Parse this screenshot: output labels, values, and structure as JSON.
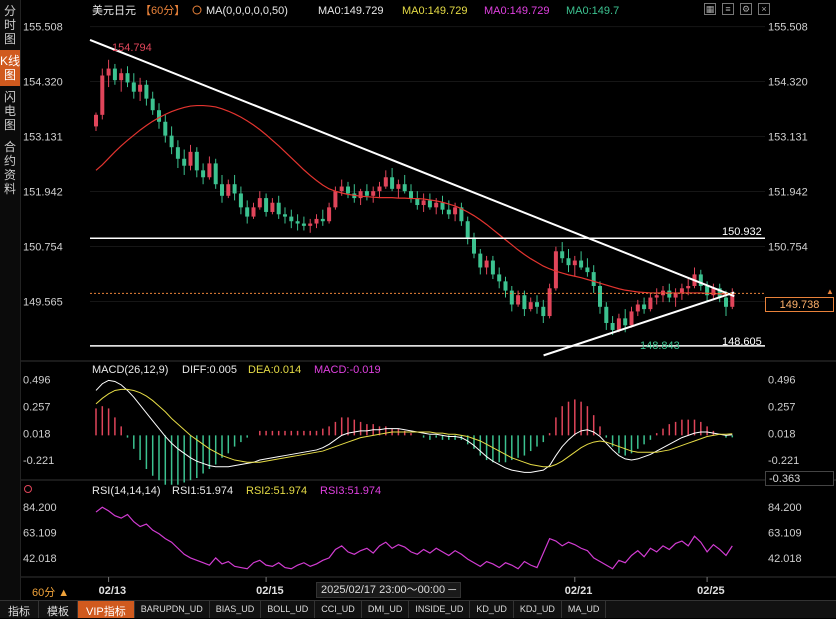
{
  "sidebar": {
    "tabs": [
      {
        "label": "分时图"
      },
      {
        "label": "K线图"
      },
      {
        "label": "闪电图"
      },
      {
        "label": "合约资料"
      }
    ],
    "active_index": 1
  },
  "header": {
    "symbol": "美元日元",
    "period": "【60分】",
    "ma_label": "MA(0,0,0,0,0,50)",
    "ma_values": [
      "MA0:149.729",
      "MA0:149.729",
      "MA0:149.729",
      "MA0:149.7"
    ]
  },
  "toolbar_icons": [
    "grid-icon",
    "list-icon",
    "settings-icon",
    "close-icon"
  ],
  "colors": {
    "up": "#e0455a",
    "down": "#3cc290",
    "ma": "#e3342f",
    "trend": "#ffffff",
    "current": "#e9823a",
    "diff": "#ffffff",
    "dea": "#e6dc46",
    "macd_text": "#e040e0",
    "rsi": "#d23cd2"
  },
  "chart_data": [
    {
      "type": "candlestick",
      "yticks": [
        "155.508",
        "154.320",
        "153.131",
        "151.942",
        "150.754",
        "149.565"
      ],
      "ylim": [
        148.3,
        155.65
      ],
      "xticks": [
        {
          "i": 2,
          "label": "02/13"
        },
        {
          "i": 27,
          "label": "02/15"
        },
        {
          "i": 76,
          "label": "02/21"
        },
        {
          "i": 97,
          "label": "02/25"
        }
      ],
      "annotations": {
        "high": "154.794",
        "low": "148.843",
        "level_1": "150.932",
        "level_2": "148.605",
        "current": "149.738"
      },
      "ohlc": [
        [
          153.35,
          153.65,
          153.25,
          153.6
        ],
        [
          153.6,
          154.6,
          153.5,
          154.45
        ],
        [
          154.45,
          154.79,
          154.2,
          154.6
        ],
        [
          154.6,
          154.7,
          154.25,
          154.35
        ],
        [
          154.35,
          154.6,
          154.1,
          154.5
        ],
        [
          154.5,
          154.65,
          154.2,
          154.3
        ],
        [
          154.3,
          154.5,
          153.95,
          154.1
        ],
        [
          154.1,
          154.4,
          153.9,
          154.25
        ],
        [
          154.25,
          154.35,
          153.8,
          153.95
        ],
        [
          153.95,
          154.1,
          153.6,
          153.7
        ],
        [
          153.7,
          153.85,
          153.3,
          153.45
        ],
        [
          153.45,
          153.6,
          153.0,
          153.15
        ],
        [
          153.15,
          153.35,
          152.75,
          152.9
        ],
        [
          152.9,
          153.05,
          152.45,
          152.65
        ],
        [
          152.65,
          152.85,
          152.3,
          152.5
        ],
        [
          152.5,
          152.95,
          152.4,
          152.8
        ],
        [
          152.8,
          152.9,
          152.25,
          152.4
        ],
        [
          152.4,
          152.55,
          152.1,
          152.25
        ],
        [
          152.25,
          152.7,
          152.2,
          152.55
        ],
        [
          152.55,
          152.65,
          152.0,
          152.1
        ],
        [
          152.1,
          152.3,
          151.7,
          151.85
        ],
        [
          151.85,
          152.2,
          151.8,
          152.1
        ],
        [
          152.1,
          152.3,
          151.75,
          151.9
        ],
        [
          151.9,
          152.05,
          151.45,
          151.6
        ],
        [
          151.6,
          151.75,
          151.25,
          151.4
        ],
        [
          151.4,
          151.7,
          151.35,
          151.6
        ],
        [
          151.6,
          151.95,
          151.55,
          151.8
        ],
        [
          151.8,
          151.9,
          151.4,
          151.5
        ],
        [
          151.5,
          151.8,
          151.45,
          151.7
        ],
        [
          151.7,
          151.85,
          151.35,
          151.45
        ],
        [
          151.45,
          151.6,
          151.25,
          151.4
        ],
        [
          151.4,
          151.55,
          151.15,
          151.3
        ],
        [
          151.3,
          151.45,
          151.1,
          151.25
        ],
        [
          151.25,
          151.4,
          151.1,
          151.2
        ],
        [
          151.2,
          151.35,
          151.05,
          151.25
        ],
        [
          151.25,
          151.45,
          151.15,
          151.35
        ],
        [
          151.35,
          151.55,
          151.2,
          151.3
        ],
        [
          151.3,
          151.7,
          151.25,
          151.6
        ],
        [
          151.6,
          152.05,
          151.55,
          151.95
        ],
        [
          151.95,
          152.2,
          151.85,
          152.05
        ],
        [
          152.05,
          152.15,
          151.8,
          151.9
        ],
        [
          151.9,
          152.1,
          151.7,
          151.8
        ],
        [
          151.8,
          152.0,
          151.65,
          151.95
        ],
        [
          151.95,
          152.1,
          151.75,
          151.85
        ],
        [
          151.85,
          152.05,
          151.7,
          151.95
        ],
        [
          151.95,
          152.15,
          151.8,
          152.05
        ],
        [
          152.05,
          152.4,
          152.0,
          152.25
        ],
        [
          152.25,
          152.45,
          151.95,
          152.0
        ],
        [
          152.0,
          152.2,
          151.8,
          152.1
        ],
        [
          152.1,
          152.3,
          151.9,
          151.95
        ],
        [
          151.95,
          152.1,
          151.7,
          151.8
        ],
        [
          151.8,
          151.95,
          151.55,
          151.65
        ],
        [
          151.65,
          151.9,
          151.5,
          151.75
        ],
        [
          151.75,
          151.9,
          151.55,
          151.6
        ],
        [
          151.6,
          151.8,
          151.45,
          151.7
        ],
        [
          151.7,
          151.85,
          151.45,
          151.55
        ],
        [
          151.55,
          151.75,
          151.35,
          151.45
        ],
        [
          151.45,
          151.7,
          151.3,
          151.6
        ],
        [
          151.6,
          151.7,
          151.2,
          151.3
        ],
        [
          151.3,
          151.4,
          150.8,
          150.95
        ],
        [
          150.95,
          151.05,
          150.5,
          150.6
        ],
        [
          150.6,
          150.7,
          150.15,
          150.3
        ],
        [
          150.3,
          150.55,
          150.15,
          150.45
        ],
        [
          150.45,
          150.55,
          150.05,
          150.15
        ],
        [
          150.15,
          150.3,
          149.85,
          150.0
        ],
        [
          150.0,
          150.1,
          149.65,
          149.8
        ],
        [
          149.8,
          149.9,
          149.35,
          149.5
        ],
        [
          149.5,
          149.8,
          149.45,
          149.7
        ],
        [
          149.7,
          149.8,
          149.25,
          149.4
        ],
        [
          149.4,
          149.65,
          149.35,
          149.55
        ],
        [
          149.55,
          149.7,
          149.3,
          149.45
        ],
        [
          149.45,
          149.6,
          149.1,
          149.25
        ],
        [
          149.25,
          149.95,
          149.2,
          149.85
        ],
        [
          149.85,
          150.75,
          149.8,
          150.65
        ],
        [
          150.65,
          150.85,
          150.4,
          150.5
        ],
        [
          150.5,
          150.7,
          150.2,
          150.35
        ],
        [
          150.35,
          150.55,
          150.1,
          150.45
        ],
        [
          150.45,
          150.65,
          150.25,
          150.3
        ],
        [
          150.3,
          150.5,
          150.1,
          150.2
        ],
        [
          150.2,
          150.35,
          149.75,
          149.9
        ],
        [
          149.9,
          150.0,
          149.3,
          149.45
        ],
        [
          149.45,
          149.55,
          148.95,
          149.1
        ],
        [
          149.1,
          149.25,
          148.84,
          148.95
        ],
        [
          148.95,
          149.3,
          148.9,
          149.2
        ],
        [
          149.2,
          149.4,
          148.9,
          149.05
        ],
        [
          149.05,
          149.45,
          149.0,
          149.35
        ],
        [
          149.35,
          149.6,
          149.25,
          149.5
        ],
        [
          149.5,
          149.65,
          149.3,
          149.4
        ],
        [
          149.4,
          149.75,
          149.35,
          149.65
        ],
        [
          149.65,
          149.85,
          149.5,
          149.7
        ],
        [
          149.7,
          149.9,
          149.55,
          149.8
        ],
        [
          149.8,
          149.95,
          149.55,
          149.65
        ],
        [
          149.65,
          149.85,
          149.45,
          149.75
        ],
        [
          149.75,
          149.95,
          149.6,
          149.85
        ],
        [
          149.85,
          150.05,
          149.7,
          149.9
        ],
        [
          149.9,
          150.3,
          149.85,
          150.15
        ],
        [
          150.15,
          150.25,
          149.8,
          149.9
        ],
        [
          149.9,
          150.0,
          149.55,
          149.7
        ],
        [
          149.7,
          149.95,
          149.6,
          149.85
        ],
        [
          149.85,
          149.95,
          149.55,
          149.65
        ],
        [
          149.65,
          149.8,
          149.25,
          149.45
        ],
        [
          149.45,
          149.85,
          149.4,
          149.74
        ]
      ],
      "ma50": [
        152.4,
        152.52,
        152.66,
        152.8,
        152.93,
        153.05,
        153.16,
        153.27,
        153.37,
        153.46,
        153.54,
        153.61,
        153.67,
        153.72,
        153.76,
        153.79,
        153.8,
        153.8,
        153.79,
        153.77,
        153.73,
        153.68,
        153.62,
        153.55,
        153.47,
        153.38,
        153.28,
        153.17,
        153.05,
        152.93,
        152.8,
        152.67,
        152.54,
        152.41,
        152.29,
        152.18,
        152.08,
        152.0,
        151.95,
        151.91,
        151.88,
        151.86,
        151.84,
        151.83,
        151.82,
        151.81,
        151.81,
        151.81,
        151.8,
        151.8,
        151.79,
        151.79,
        151.78,
        151.76,
        151.74,
        151.71,
        151.67,
        151.63,
        151.57,
        151.5,
        151.42,
        151.33,
        151.23,
        151.12,
        151.01,
        150.9,
        150.79,
        150.68,
        150.58,
        150.49,
        150.41,
        150.33,
        150.27,
        150.22,
        150.18,
        150.14,
        150.11,
        150.08,
        150.04,
        150.0,
        149.96,
        149.92,
        149.88,
        149.84,
        149.81,
        149.79,
        149.77,
        149.76,
        149.75,
        149.75,
        149.75,
        149.75,
        149.75,
        149.75,
        149.75,
        149.75,
        149.75,
        149.74,
        149.74,
        149.73,
        149.73,
        149.73
      ],
      "trendlines": [
        {
          "from": [
            0,
            155.22
          ],
          "to": [
            101,
            149.68
          ]
        },
        {
          "from": [
            72,
            148.4
          ],
          "to": [
            101,
            149.76
          ]
        }
      ],
      "hlines": [
        150.932,
        148.605
      ]
    },
    {
      "type": "macd",
      "label": "MACD(26,12,9)",
      "diff_label": "DIFF:0.005",
      "dea_label": "DEA:0.014",
      "macd_label": "MACD:-0.019",
      "yticks": [
        "0.496",
        "0.257",
        "0.018",
        "-0.221"
      ],
      "ylim": [
        -0.38,
        0.52
      ],
      "current": "-0.363",
      "diff": [
        0.4,
        0.46,
        0.49,
        0.48,
        0.45,
        0.4,
        0.34,
        0.27,
        0.2,
        0.13,
        0.06,
        -0.01,
        -0.07,
        -0.12,
        -0.16,
        -0.2,
        -0.23,
        -0.25,
        -0.27,
        -0.28,
        -0.28,
        -0.28,
        -0.27,
        -0.26,
        -0.25,
        -0.24,
        -0.22,
        -0.21,
        -0.2,
        -0.19,
        -0.18,
        -0.17,
        -0.16,
        -0.15,
        -0.14,
        -0.13,
        -0.11,
        -0.08,
        -0.04,
        0.0,
        0.02,
        0.03,
        0.04,
        0.04,
        0.05,
        0.05,
        0.06,
        0.06,
        0.06,
        0.05,
        0.04,
        0.03,
        0.02,
        0.01,
        0.01,
        0.0,
        -0.01,
        -0.01,
        -0.02,
        -0.05,
        -0.09,
        -0.14,
        -0.19,
        -0.23,
        -0.26,
        -0.29,
        -0.31,
        -0.32,
        -0.33,
        -0.33,
        -0.32,
        -0.31,
        -0.27,
        -0.18,
        -0.1,
        -0.04,
        0.01,
        0.04,
        0.05,
        0.03,
        -0.01,
        -0.07,
        -0.13,
        -0.18,
        -0.21,
        -0.22,
        -0.21,
        -0.19,
        -0.17,
        -0.14,
        -0.11,
        -0.08,
        -0.05,
        -0.02,
        0.0,
        0.02,
        0.03,
        0.03,
        0.02,
        0.01,
        0.0,
        0.005
      ],
      "dea": [
        0.28,
        0.33,
        0.37,
        0.4,
        0.41,
        0.41,
        0.4,
        0.38,
        0.35,
        0.31,
        0.26,
        0.21,
        0.15,
        0.1,
        0.05,
        0.0,
        -0.04,
        -0.08,
        -0.12,
        -0.15,
        -0.18,
        -0.2,
        -0.22,
        -0.23,
        -0.24,
        -0.24,
        -0.24,
        -0.23,
        -0.22,
        -0.21,
        -0.2,
        -0.19,
        -0.18,
        -0.17,
        -0.16,
        -0.15,
        -0.14,
        -0.12,
        -0.1,
        -0.08,
        -0.06,
        -0.04,
        -0.02,
        -0.01,
        0.0,
        0.01,
        0.02,
        0.03,
        0.03,
        0.03,
        0.03,
        0.03,
        0.03,
        0.03,
        0.02,
        0.02,
        0.01,
        0.01,
        0.0,
        -0.01,
        -0.03,
        -0.05,
        -0.08,
        -0.11,
        -0.14,
        -0.17,
        -0.2,
        -0.22,
        -0.24,
        -0.26,
        -0.27,
        -0.28,
        -0.28,
        -0.26,
        -0.23,
        -0.19,
        -0.15,
        -0.11,
        -0.08,
        -0.06,
        -0.05,
        -0.06,
        -0.08,
        -0.1,
        -0.12,
        -0.14,
        -0.15,
        -0.15,
        -0.15,
        -0.15,
        -0.14,
        -0.13,
        -0.11,
        -0.09,
        -0.07,
        -0.05,
        -0.03,
        -0.01,
        0.0,
        0.01,
        0.01,
        0.014
      ]
    },
    {
      "type": "line",
      "label": "RSI(14,14,14)",
      "values_label": [
        "RSI1:51.974",
        "RSI2:51.974",
        "RSI3:51.974"
      ],
      "yticks": [
        "84.200",
        "63.109",
        "42.018"
      ],
      "ylim": [
        27,
        90
      ],
      "rsi": [
        80,
        84,
        81,
        77,
        75,
        78,
        72,
        68,
        70,
        65,
        62,
        58,
        55,
        50,
        45,
        42,
        40,
        38,
        36,
        42,
        37,
        39,
        35,
        34,
        33,
        38,
        40,
        36,
        35,
        38,
        34,
        33,
        36,
        38,
        35,
        37,
        40,
        42,
        49,
        52,
        47,
        45,
        48,
        50,
        46,
        52,
        55,
        50,
        53,
        51,
        47,
        45,
        49,
        46,
        50,
        47,
        44,
        48,
        45,
        41,
        38,
        35,
        39,
        37,
        34,
        38,
        36,
        33,
        39,
        36,
        34,
        46,
        58,
        56,
        52,
        55,
        53,
        50,
        48,
        42,
        39,
        36,
        33,
        40,
        38,
        44,
        48,
        43,
        50,
        47,
        52,
        49,
        54,
        56,
        52,
        60,
        55,
        47,
        53,
        49,
        44,
        51.97
      ]
    }
  ],
  "cursor_time": "2025/02/17 23:00～00:00 ─",
  "period_footer": "60分 ▲",
  "bottom_tabs": [
    "指标",
    "模板",
    "VIP指标",
    "BARUPDN_UD",
    "BIAS_UD",
    "BOLL_UD",
    "CCI_UD",
    "DMI_UD",
    "INSIDE_UD",
    "KD_UD",
    "KDJ_UD",
    "MA_UD"
  ]
}
